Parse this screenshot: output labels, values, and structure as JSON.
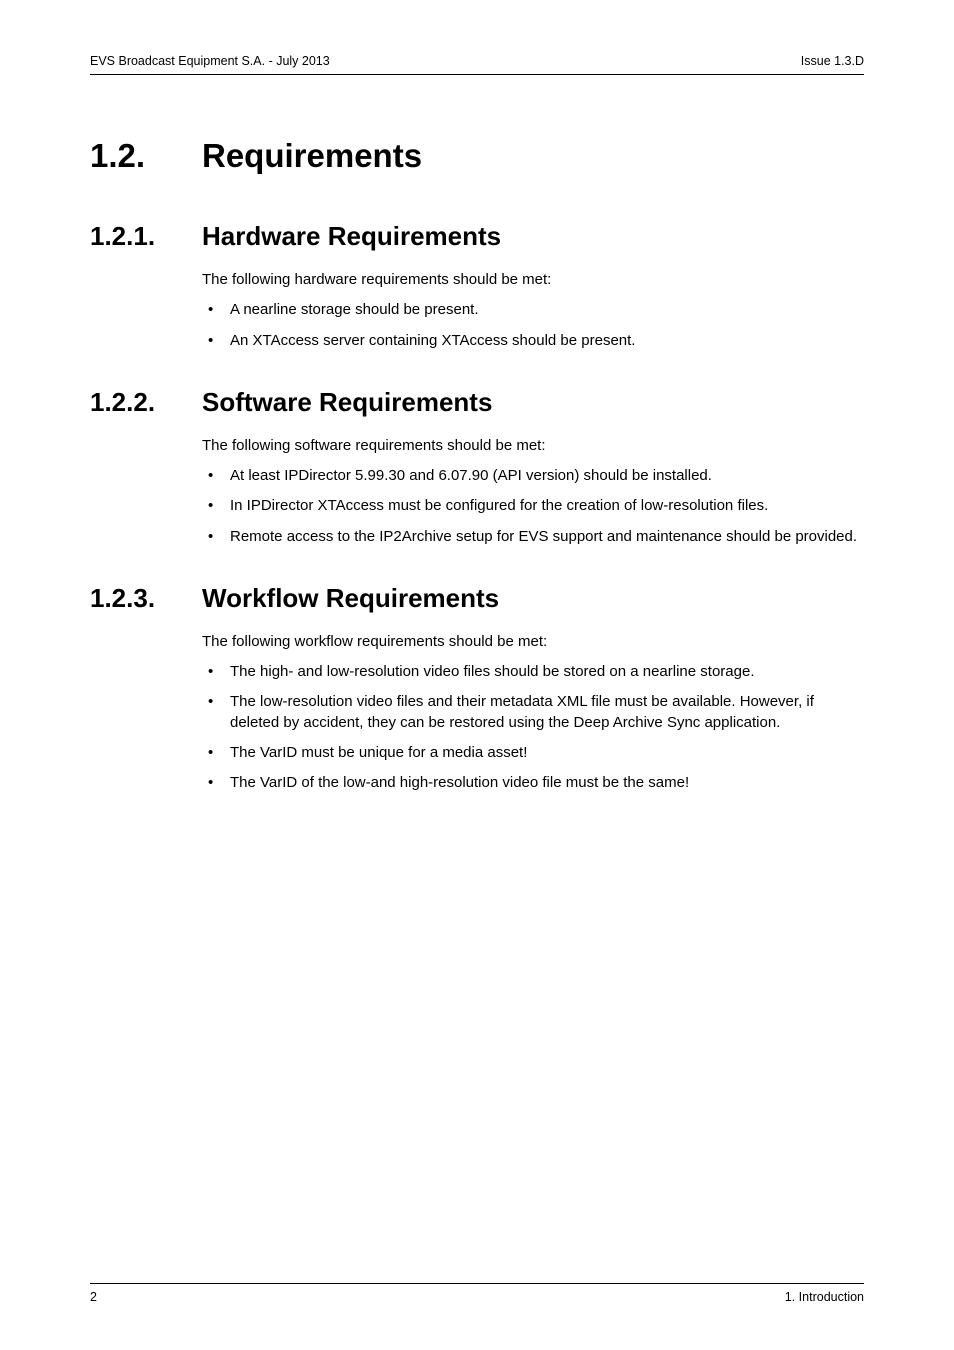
{
  "header": {
    "left": "EVS Broadcast Equipment S.A.  - July 2013",
    "right": "Issue 1.3.D"
  },
  "section": {
    "number": "1.2.",
    "title": "Requirements"
  },
  "subsections": [
    {
      "number": "1.2.1.",
      "title": "Hardware Requirements",
      "intro": "The following hardware requirements should be met:",
      "bullets": [
        "A nearline storage should be present.",
        "An XTAccess server containing XTAccess should be present."
      ]
    },
    {
      "number": "1.2.2.",
      "title": "Software Requirements",
      "intro": "The following software requirements should be met:",
      "bullets": [
        "At least IPDirector 5.99.30 and 6.07.90 (API version) should be installed.",
        "In IPDirector XTAccess must be configured for the creation of low-resolution files.",
        "Remote access to the IP2Archive setup for EVS support and maintenance should be provided."
      ]
    },
    {
      "number": "1.2.3.",
      "title": "Workflow Requirements",
      "intro": "The following workflow requirements should be met:",
      "bullets": [
        "The high- and low-resolution video files should be stored on a nearline storage.",
        "The low-resolution video files and their metadata XML file must be available. However, if deleted by accident, they can be restored using the Deep Archive Sync application.",
        "The VarID must be unique for a media asset!",
        "The VarID of the low-and high-resolution video file must be the same!"
      ]
    }
  ],
  "footer": {
    "page": "2",
    "chapter": "1. Introduction"
  }
}
